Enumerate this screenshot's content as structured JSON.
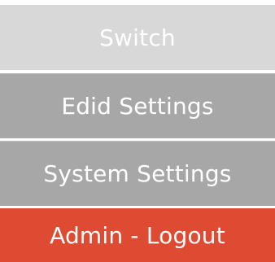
{
  "menu": {
    "items": [
      {
        "label": "Switch",
        "state": "inactive-light"
      },
      {
        "label": "Edid Settings",
        "state": "normal"
      },
      {
        "label": "System Settings",
        "state": "normal"
      },
      {
        "label": "Admin - Logout",
        "state": "logout"
      }
    ]
  },
  "colors": {
    "switch_bg": "#d8d8d8",
    "item_bg": "#a7a7a7",
    "logout_bg": "#de4a32",
    "text": "#ffffff"
  }
}
